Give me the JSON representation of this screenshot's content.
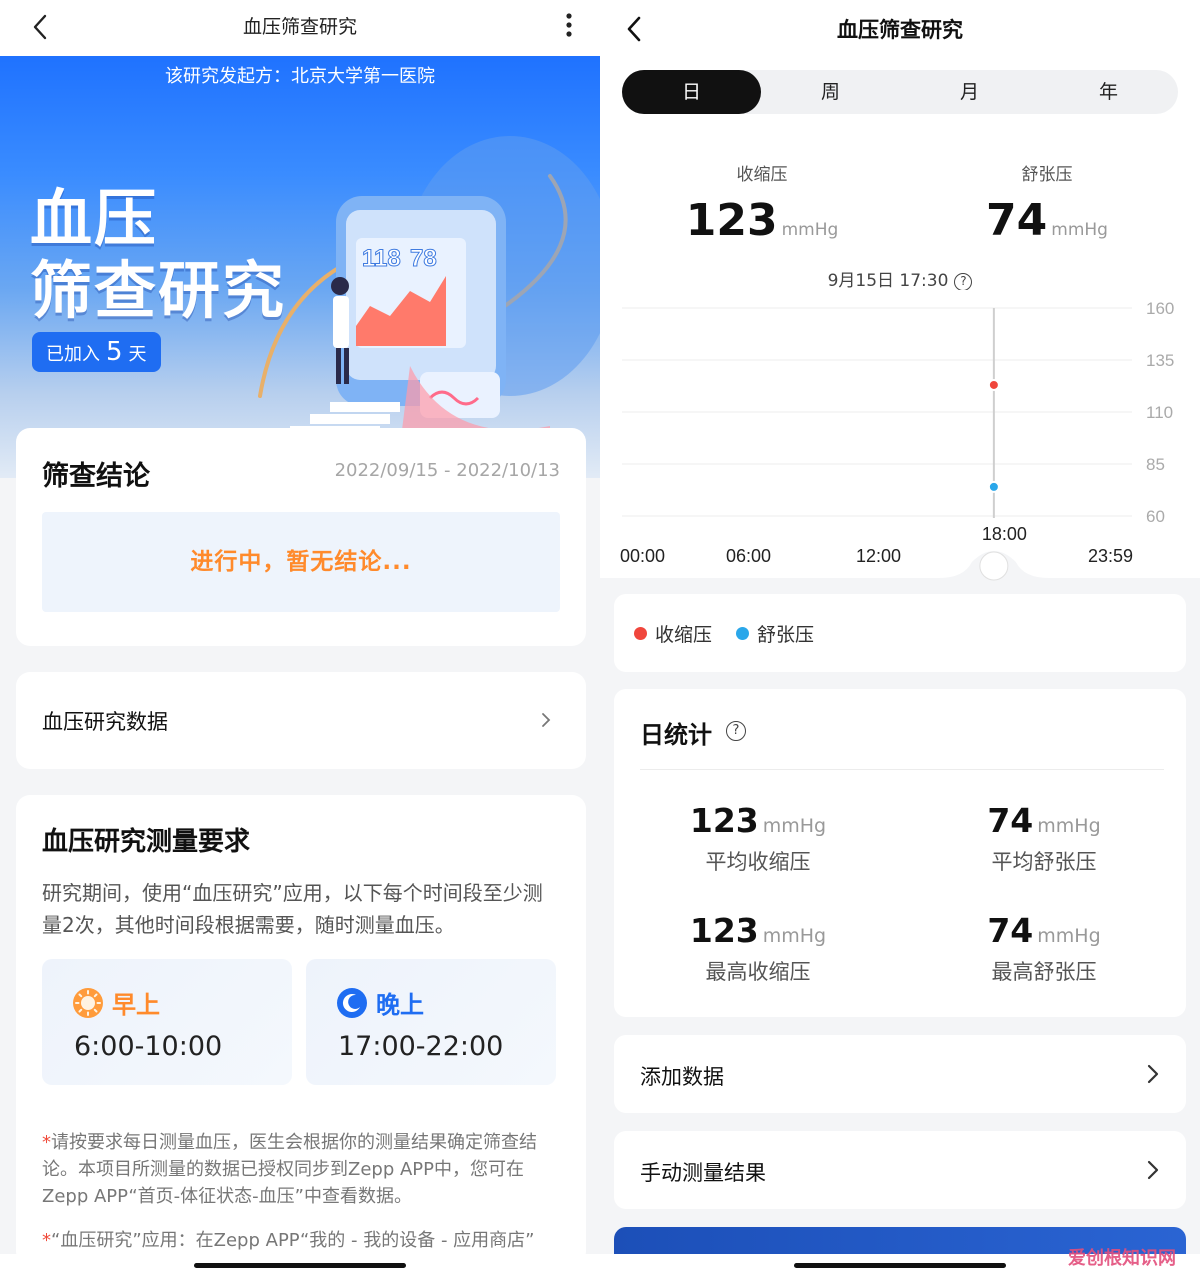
{
  "left": {
    "header": {
      "title": "血压筛查研究"
    },
    "hero": {
      "sponsor": "该研究发起方：北京大学第一医院",
      "title_line1": "血压",
      "title_line2": "筛查研究",
      "joined_prefix": "已加入",
      "joined_days": "5",
      "joined_suffix": "天",
      "illus_sys": "118",
      "illus_dia": "78"
    },
    "result_card": {
      "title": "筛查结论",
      "date_range": "2022/09/15 - 2022/10/13",
      "status": "进行中，暂无结论..."
    },
    "data_card": {
      "label": "血压研究数据"
    },
    "requirements": {
      "title": "血压研究测量要求",
      "description": "研究期间，使用“血压研究”应用，以下每个时间段至少测量2次，其他时间段根据需要，随时测量血压。",
      "morning": {
        "name": "早上",
        "time": "6:00-10:00"
      },
      "evening": {
        "name": "晚上",
        "time": "17:00-22:00"
      },
      "note1_star": "*",
      "note1": "请按要求每日测量血压，医生会根据你的测量结果确定筛查结论。本项目所测量的数据已授权同步到Zepp APP中，您可在Zepp APP“首页-体征状态-血压”中查看数据。",
      "note2_star": "*",
      "note2": "“血压研究”应用：在Zepp APP“我的 - 我的设备 - 应用商店”"
    }
  },
  "right": {
    "header": {
      "title": "血压筛查研究"
    },
    "tabs": [
      {
        "label": "日",
        "active": true
      },
      {
        "label": "周",
        "active": false
      },
      {
        "label": "月",
        "active": false
      },
      {
        "label": "年",
        "active": false
      }
    ],
    "systolic": {
      "label": "收缩压",
      "value": "123",
      "unit": "mmHg"
    },
    "diastolic": {
      "label": "舒张压",
      "value": "74",
      "unit": "mmHg"
    },
    "timestamp": "9月15日 17:30",
    "legend": [
      {
        "label": "收缩压",
        "color": "#f0463c"
      },
      {
        "label": "舒张压",
        "color": "#2aa7ea"
      }
    ],
    "stats": {
      "title": "日统计",
      "items": [
        {
          "value": "123",
          "unit": "mmHg",
          "label": "平均收缩压"
        },
        {
          "value": "74",
          "unit": "mmHg",
          "label": "平均舒张压"
        },
        {
          "value": "123",
          "unit": "mmHg",
          "label": "最高收缩压"
        },
        {
          "value": "74",
          "unit": "mmHg",
          "label": "最高舒张压"
        }
      ]
    },
    "rows": {
      "add_data": "添加数据",
      "manual_results": "手动测量结果"
    },
    "watermark": "爱创根知识网"
  },
  "chart_data": {
    "type": "scatter",
    "x_ticks": [
      "00:00",
      "06:00",
      "12:00",
      "18:00",
      "23:59"
    ],
    "y_ticks": [
      160,
      135,
      110,
      85,
      60
    ],
    "ylim": [
      60,
      160
    ],
    "xlim_hours": [
      0,
      24
    ],
    "selected_time_hours": 17.5,
    "series": [
      {
        "name": "收缩压",
        "color": "#f0463c",
        "points": [
          {
            "x_hours": 17.5,
            "y": 123
          }
        ]
      },
      {
        "name": "舒张压",
        "color": "#2aa7ea",
        "points": [
          {
            "x_hours": 17.5,
            "y": 74
          }
        ]
      }
    ],
    "grid": true
  }
}
